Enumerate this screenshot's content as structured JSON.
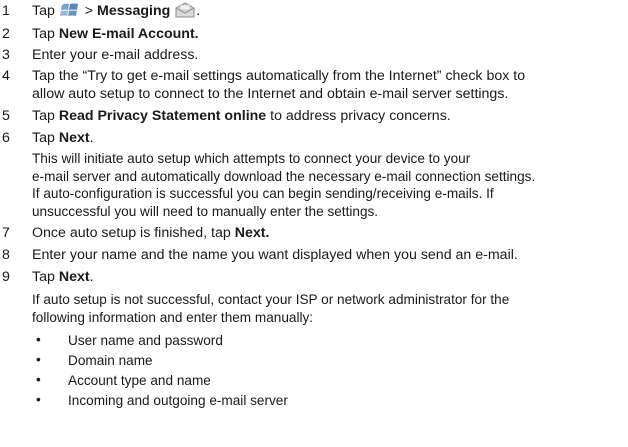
{
  "steps": [
    {
      "num": "1",
      "pre": "Tap ",
      "mid": " > ",
      "bold": "Messaging",
      "post": "."
    },
    {
      "num": "2",
      "pre": "Tap ",
      "bold": "New E-mail Account."
    },
    {
      "num": "3",
      "text": "Enter your e-mail address."
    },
    {
      "num": "4",
      "line1": "Tap the “Try to get e-mail settings automatically from the Internet” check box to",
      "line2": "allow auto setup to connect to the Internet and obtain e-mail server settings."
    },
    {
      "num": "5",
      "pre": "Tap ",
      "bold": "Read Privacy Statement online",
      "post": " to address privacy concerns."
    },
    {
      "num": "6",
      "pre": "Tap ",
      "bold": "Next",
      "post": "."
    },
    {
      "num": "7",
      "pre": "Once auto setup is finished, tap ",
      "bold": "Next."
    },
    {
      "num": "8",
      "text": "Enter your name and the name you want displayed when you send an e-mail."
    },
    {
      "num": "9",
      "pre": "Tap ",
      "bold": "Next",
      "post": "."
    }
  ],
  "step6_note": [
    "This will initiate auto setup which attempts to connect your device to your",
    "e-mail server and automatically download the necessary e-mail connection settings.",
    "If auto-configuration is successful you can begin sending/receiving e-mails. If",
    "unsuccessful you will need to manually enter the settings."
  ],
  "step9_note": [
    "If auto setup is not successful, contact your ISP or network administrator for the",
    "following information and enter them manually:"
  ],
  "bullet_char": "•",
  "bullets": [
    "User name and password",
    "Domain name",
    "Account type and name",
    "Incoming and outgoing e-mail server"
  ],
  "icons": {
    "start": "windows-start-icon",
    "messaging": "envelope-icon"
  }
}
